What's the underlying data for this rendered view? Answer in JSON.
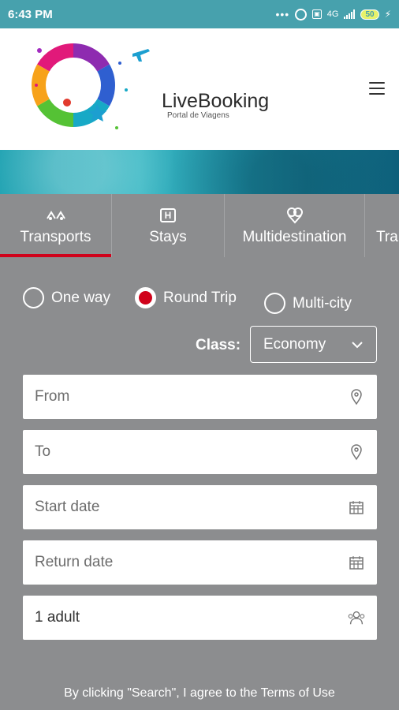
{
  "status_bar": {
    "time": "6:43 PM",
    "network": "4G",
    "battery": "50"
  },
  "header": {
    "brand_name": "LiveBooking",
    "brand_subtitle": "Portal de Viagens"
  },
  "tabs": [
    {
      "label": "Transports",
      "icon": "transport-icon",
      "active": true
    },
    {
      "label": "Stays",
      "icon": "hotel-icon",
      "active": false
    },
    {
      "label": "Multidestination",
      "icon": "multidestination-icon",
      "active": false
    },
    {
      "label": "Tra",
      "icon": "",
      "active": false
    }
  ],
  "trip_type": {
    "options": [
      {
        "label": "One way",
        "checked": false
      },
      {
        "label": "Round Trip",
        "checked": true
      },
      {
        "label": "Multi-city",
        "checked": false
      }
    ]
  },
  "class_select": {
    "label": "Class:",
    "value": "Economy"
  },
  "fields": {
    "from_placeholder": "From",
    "to_placeholder": "To",
    "start_date_placeholder": "Start date",
    "return_date_placeholder": "Return date",
    "passengers_value": "1 adult"
  },
  "terms_text": "By clicking \"Search\", I agree to the Terms of Use",
  "colors": {
    "status_bar": "#47a1ad",
    "panel": "#8c8d8f",
    "accent": "#d0021b"
  }
}
